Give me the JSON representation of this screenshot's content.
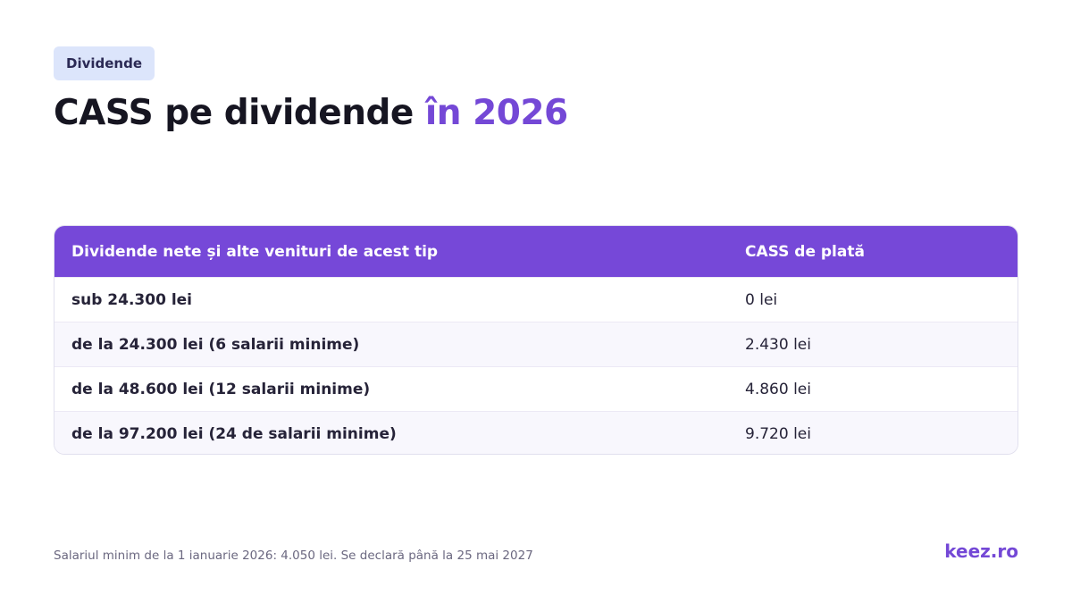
{
  "badge": "Dividende",
  "title": {
    "main": "CASS pe dividende ",
    "accent": "în 2026"
  },
  "table": {
    "headers": [
      "Dividende nete și alte venituri de acest tip",
      "CASS de plată"
    ],
    "rows": [
      [
        "sub 24.300 lei",
        "0 lei"
      ],
      [
        "de la 24.300 lei (6 salarii minime)",
        "2.430 lei"
      ],
      [
        "de la 48.600 lei (12 salarii minime)",
        "4.860 lei"
      ],
      [
        "de la 97.200 lei (24 de salarii minime)",
        "9.720 lei"
      ]
    ]
  },
  "footnote": "Salariul minim de la 1 ianuarie 2026: 4.050 lei. Se declară până la 25 mai 2027",
  "brand": "keez.ro",
  "colors": {
    "accent": "#7448d6",
    "header_bg": "#7648d8",
    "badge_bg": "#dce5fb"
  }
}
